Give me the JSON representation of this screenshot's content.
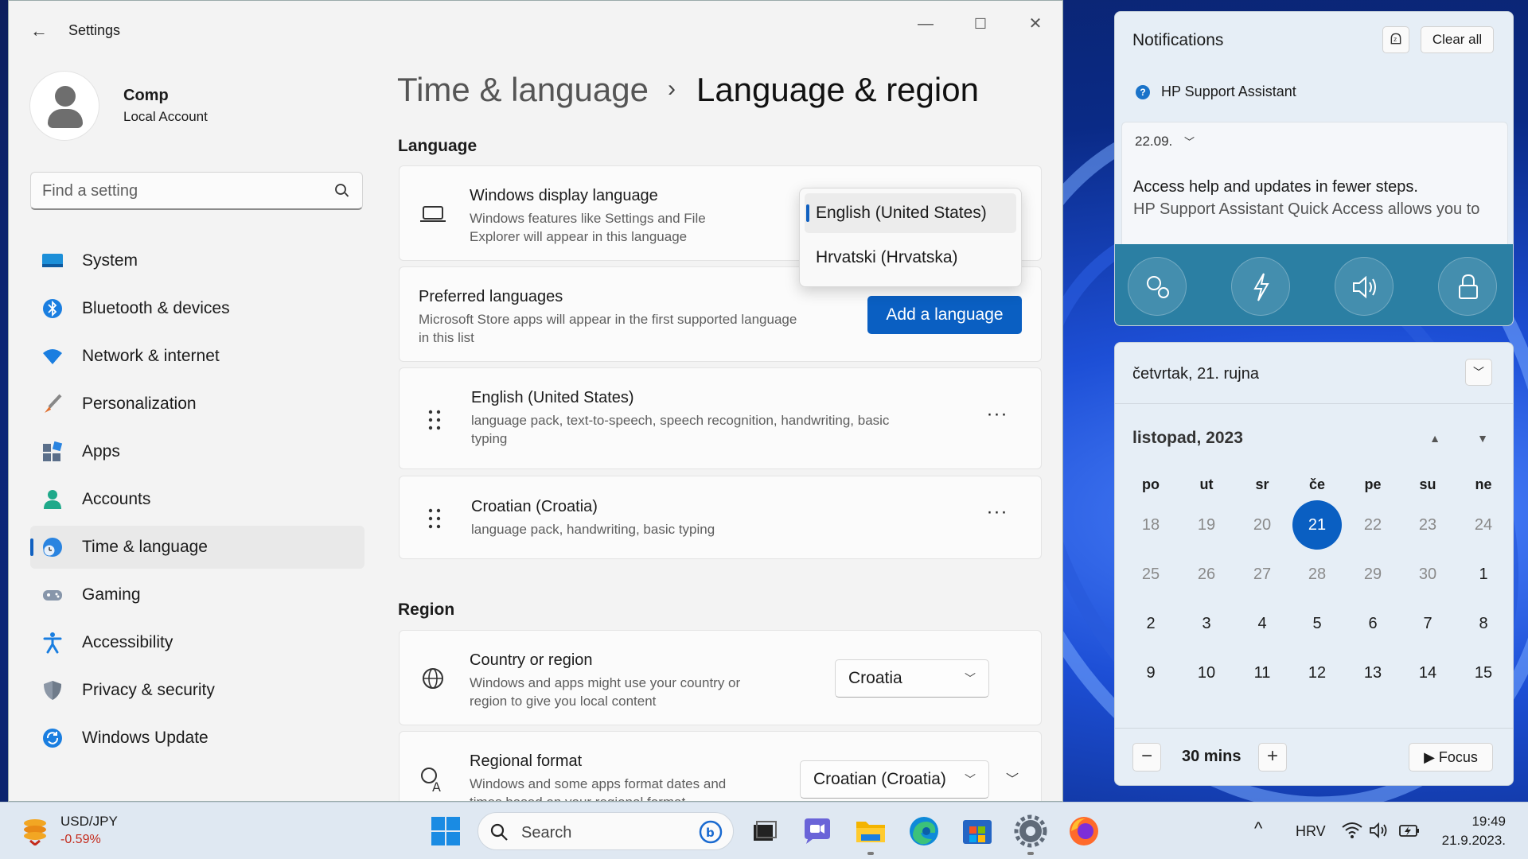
{
  "window": {
    "title": "Settings",
    "back_icon": "back-arrow-icon",
    "minimize_glyph": "—",
    "maximize_glyph": "☐",
    "close_glyph": "✕"
  },
  "profile": {
    "name": "Comp",
    "account_type": "Local Account"
  },
  "search": {
    "placeholder": "Find a setting"
  },
  "sidebar": {
    "items": [
      {
        "label": "System",
        "icon": "system-icon"
      },
      {
        "label": "Bluetooth & devices",
        "icon": "bluetooth-icon"
      },
      {
        "label": "Network & internet",
        "icon": "wifi-icon"
      },
      {
        "label": "Personalization",
        "icon": "brush-icon"
      },
      {
        "label": "Apps",
        "icon": "apps-icon"
      },
      {
        "label": "Accounts",
        "icon": "accounts-icon"
      },
      {
        "label": "Time & language",
        "icon": "time-language-icon",
        "active": true
      },
      {
        "label": "Gaming",
        "icon": "gamepad-icon"
      },
      {
        "label": "Accessibility",
        "icon": "accessibility-icon"
      },
      {
        "label": "Privacy & security",
        "icon": "shield-icon"
      },
      {
        "label": "Windows Update",
        "icon": "update-icon"
      }
    ]
  },
  "breadcrumb": {
    "parent": "Time & language",
    "separator": "›",
    "current": "Language & region"
  },
  "language_section": {
    "title": "Language",
    "display_language": {
      "title": "Windows display language",
      "subtitle_line1": "Windows features like Settings and File",
      "subtitle_line2": "Explorer will appear in this language",
      "icon": "laptop-icon",
      "options": [
        "English (United States)",
        "Hrvatski (Hrvatska)"
      ],
      "selected": "English (United States)"
    },
    "preferred": {
      "title": "Preferred languages",
      "subtitle_line1": "Microsoft Store apps will appear in the first supported language",
      "subtitle_line2": "in this list",
      "button": "Add a language"
    },
    "languages": [
      {
        "name": "English (United States)",
        "features_line1": "language pack, text-to-speech, speech recognition, handwriting, basic",
        "features_line2": "typing",
        "more": "···"
      },
      {
        "name": "Croatian (Croatia)",
        "features_line1": "language pack, handwriting, basic typing",
        "more": "···"
      }
    ]
  },
  "region_section": {
    "title": "Region",
    "country": {
      "title": "Country or region",
      "subtitle_line1": "Windows and apps might use your country or",
      "subtitle_line2": "region to give you local content",
      "value": "Croatia",
      "icon": "globe-icon"
    },
    "format": {
      "title": "Regional format",
      "subtitle_line1": "Windows and some apps format dates and",
      "subtitle_line2": "times based on your regional format",
      "value": "Croatian (Croatia)",
      "icon": "regional-format-icon"
    }
  },
  "notifications": {
    "title": "Notifications",
    "clear_all": "Clear all",
    "app_name": "HP Support Assistant",
    "date": "22.09.",
    "headline": "Access help and updates in fewer steps.",
    "body": "HP Support Assistant Quick Access allows you to",
    "image_icons": [
      "settings-gears-icon",
      "lightning-icon",
      "speaker-icon",
      "lock-icon"
    ]
  },
  "calendar": {
    "today_label": "četvrtak, 21. rujna",
    "month_label": "listopad, 2023",
    "weekdays": [
      "po",
      "ut",
      "sr",
      "če",
      "pe",
      "su",
      "ne"
    ],
    "weeks": [
      [
        {
          "d": "18",
          "dim": true
        },
        {
          "d": "19",
          "dim": true
        },
        {
          "d": "20",
          "dim": true
        },
        {
          "d": "21",
          "today": true
        },
        {
          "d": "22",
          "dim": true
        },
        {
          "d": "23",
          "dim": true
        },
        {
          "d": "24",
          "dim": true
        }
      ],
      [
        {
          "d": "25",
          "dim": true
        },
        {
          "d": "26",
          "dim": true
        },
        {
          "d": "27",
          "dim": true
        },
        {
          "d": "28",
          "dim": true
        },
        {
          "d": "29",
          "dim": true
        },
        {
          "d": "30",
          "dim": true
        },
        {
          "d": "1"
        }
      ],
      [
        {
          "d": "2"
        },
        {
          "d": "3"
        },
        {
          "d": "4"
        },
        {
          "d": "5"
        },
        {
          "d": "6"
        },
        {
          "d": "7"
        },
        {
          "d": "8"
        }
      ],
      [
        {
          "d": "9"
        },
        {
          "d": "10"
        },
        {
          "d": "11"
        },
        {
          "d": "12"
        },
        {
          "d": "13"
        },
        {
          "d": "14"
        },
        {
          "d": "15"
        }
      ]
    ],
    "focus": {
      "minus": "−",
      "duration": "30 mins",
      "plus": "+",
      "button": "▶ Focus"
    }
  },
  "taskbar": {
    "widget": {
      "symbol": "USD/JPY",
      "change": "-0.59%"
    },
    "search_label": "Search",
    "apps": [
      "start-icon",
      "task-view-icon",
      "teams-chat-icon",
      "file-explorer-icon",
      "edge-icon",
      "store-icon",
      "settings-icon",
      "firefox-icon"
    ],
    "tray": {
      "chevron": "^",
      "language": "HRV"
    },
    "time": "19:49",
    "date": "21.9.2023."
  },
  "colors": {
    "accent": "#0a5fc2",
    "negative": "#c42b1c",
    "window_bg": "#f3f3f3"
  }
}
